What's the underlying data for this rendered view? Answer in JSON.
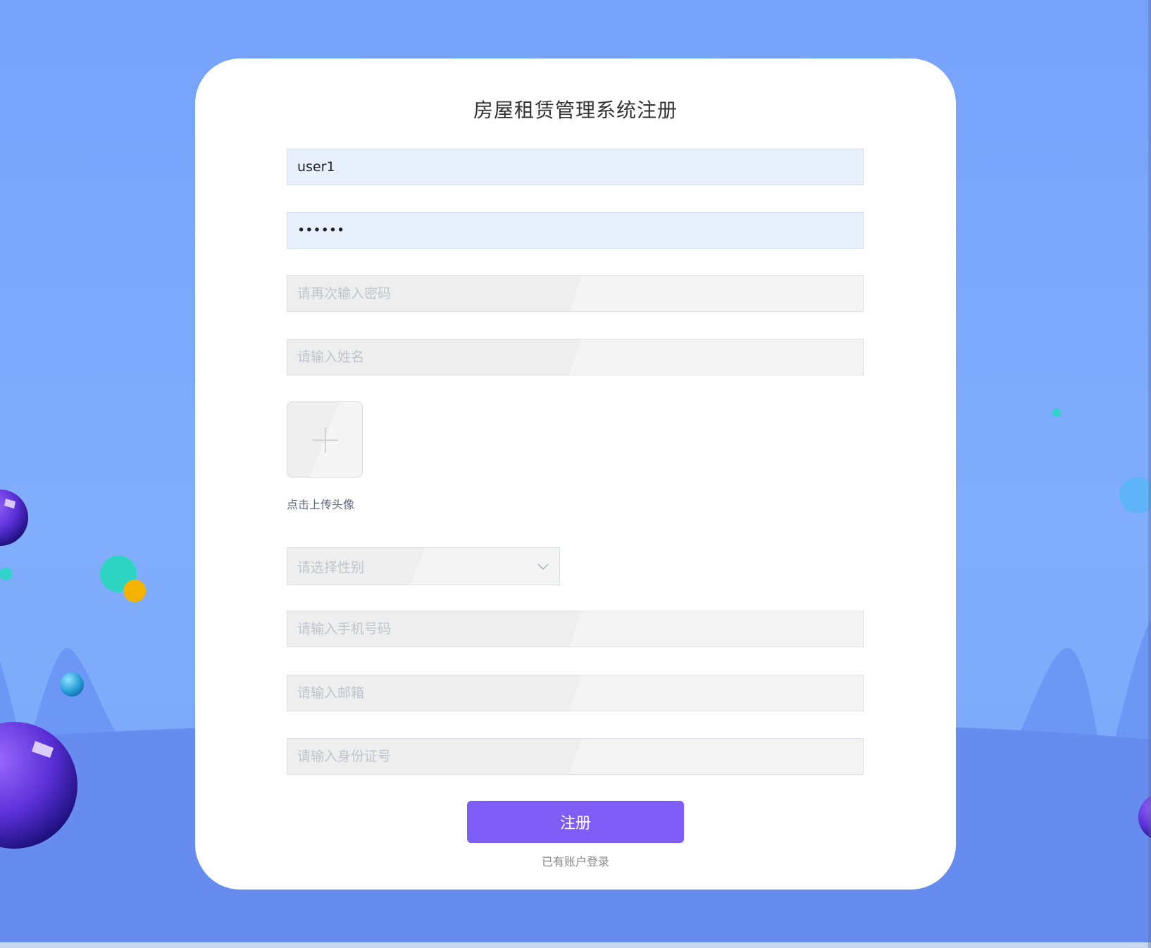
{
  "page": {
    "title": "房屋租赁管理系统注册"
  },
  "form": {
    "username": {
      "value": "user1",
      "placeholder": ""
    },
    "password": {
      "value": "123456",
      "placeholder": ""
    },
    "confirm_password": {
      "value": "",
      "placeholder": "请再次输入密码"
    },
    "name": {
      "value": "",
      "placeholder": "请输入姓名"
    },
    "avatar": {
      "tip": "点击上传头像",
      "icon": "plus-icon"
    },
    "gender": {
      "placeholder": "请选择性别",
      "icon": "chevron-down-icon"
    },
    "phone": {
      "value": "",
      "placeholder": "请输入手机号码"
    },
    "email": {
      "value": "",
      "placeholder": "请输入邮箱"
    },
    "id_card": {
      "value": "",
      "placeholder": "请输入身份证号"
    },
    "submit_label": "注册",
    "login_link": "已有账户登录"
  },
  "colors": {
    "background": "#7aa6fb",
    "card": "#ffffff",
    "primary_button": "#7f5ef7",
    "filled_input": "#e8f0fe",
    "placeholder": "#c0c4cc"
  }
}
